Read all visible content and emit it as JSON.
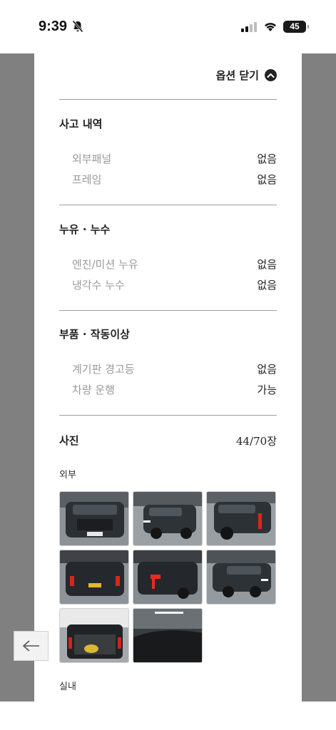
{
  "status_bar": {
    "time": "9:39",
    "battery": "45"
  },
  "header": {
    "close_label": "옵션 닫기"
  },
  "sections": {
    "accident": {
      "title": "사고 내역",
      "rows": [
        {
          "label": "외부패널",
          "value": "없음"
        },
        {
          "label": "프레임",
          "value": "없음"
        }
      ]
    },
    "leak": {
      "title": "누유 · 누수",
      "rows": [
        {
          "label": "엔진/미션 누유",
          "value": "없음"
        },
        {
          "label": "냉각수 누수",
          "value": "없음"
        }
      ]
    },
    "parts": {
      "title": "부품 · 작동이상",
      "rows": [
        {
          "label": "계기판 경고등",
          "value": "없음"
        },
        {
          "label": "차량 운행",
          "value": "가능"
        }
      ]
    }
  },
  "photos": {
    "title": "사진",
    "count": "44/70장",
    "exterior_label": "외부",
    "interior_label": "실내",
    "exterior_images": [
      "car-front-photo",
      "car-front-left-photo",
      "car-rear-right-photo",
      "car-rear-photo",
      "car-rear-left-photo",
      "car-front-right-photo",
      "car-trunk-open-photo",
      "car-roof-photo"
    ]
  }
}
